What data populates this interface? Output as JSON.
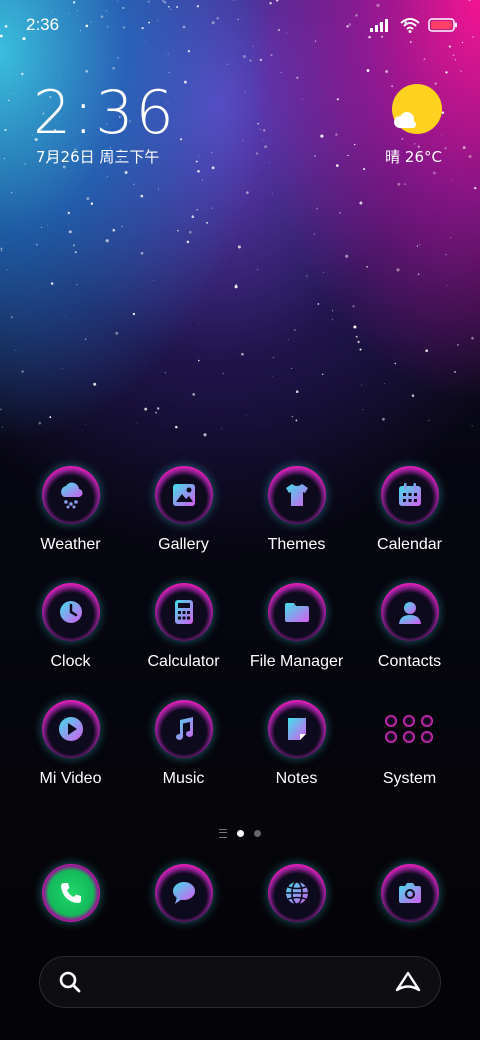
{
  "status_bar": {
    "time": "2:36"
  },
  "clock_widget": {
    "time": "2:36",
    "date": "7月26日 周三下午"
  },
  "weather_widget": {
    "text": "晴 26°C",
    "icon": "sunny-partly-cloudy-icon",
    "sun_color": "#ffd21f"
  },
  "apps": [
    {
      "label": "Weather",
      "icon": "weather-snow-cloud-icon"
    },
    {
      "label": "Gallery",
      "icon": "gallery-image-icon"
    },
    {
      "label": "Themes",
      "icon": "tshirt-icon"
    },
    {
      "label": "Calendar",
      "icon": "calendar-icon"
    },
    {
      "label": "Clock",
      "icon": "clock-icon"
    },
    {
      "label": "Calculator",
      "icon": "calculator-icon"
    },
    {
      "label": "File Manager",
      "icon": "folder-icon"
    },
    {
      "label": "Contacts",
      "icon": "contact-person-icon"
    },
    {
      "label": "Mi Video",
      "icon": "play-icon"
    },
    {
      "label": "Music",
      "icon": "music-note-icon"
    },
    {
      "label": "Notes",
      "icon": "notes-icon"
    },
    {
      "label": "System",
      "icon": "folder-grid-icon"
    }
  ],
  "dock": [
    {
      "name": "phone",
      "icon": "phone-icon"
    },
    {
      "name": "messages",
      "icon": "chat-bubble-icon"
    },
    {
      "name": "browser",
      "icon": "globe-icon"
    },
    {
      "name": "camera",
      "icon": "camera-icon"
    }
  ],
  "pager": {
    "pages": 2,
    "active": 1
  },
  "search_bar": {
    "left_icon": "search-icon",
    "right_icon": "assistant-a-icon"
  },
  "colors": {
    "accent_pink": "#e41cb6",
    "accent_cyan": "#24c3cf",
    "icon_grad_start": "#3fe0ea",
    "icon_grad_end": "#d65cf0"
  }
}
